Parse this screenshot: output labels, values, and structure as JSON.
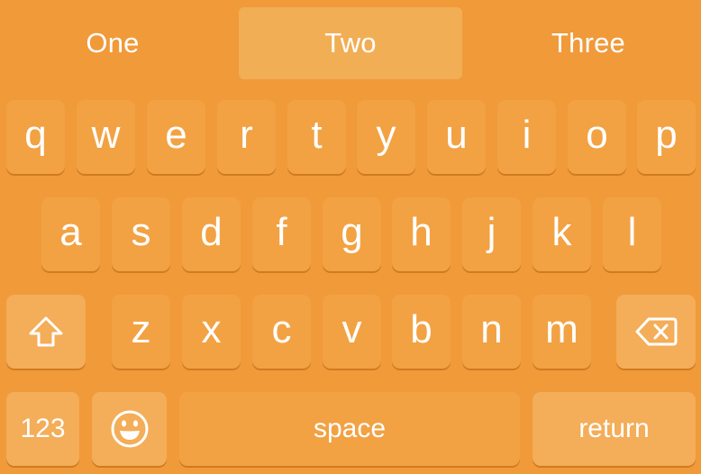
{
  "suggestions": [
    "One",
    "Two",
    "Three"
  ],
  "selected_suggestion": "Two",
  "rows": {
    "row1": [
      "q",
      "w",
      "e",
      "r",
      "t",
      "y",
      "u",
      "i",
      "o",
      "p"
    ],
    "row2": [
      "a",
      "s",
      "d",
      "f",
      "g",
      "h",
      "j",
      "k",
      "l"
    ],
    "row3": [
      "z",
      "x",
      "c",
      "v",
      "b",
      "n",
      "m"
    ]
  },
  "function_keys": {
    "shift_icon": "shift-arrow-icon",
    "delete_icon": "delete-backspace-icon",
    "numbers_label": "123",
    "emoji_icon": "smiley-face-icon",
    "space_label": "space",
    "return_label": "return"
  },
  "colors": {
    "keyboard_background": "#F09A3A",
    "key_background": "#F2A243",
    "function_key_background": "#F4AD58",
    "selected_suggestion_background": "#F2AE55",
    "key_text": "#FFFFFF"
  }
}
